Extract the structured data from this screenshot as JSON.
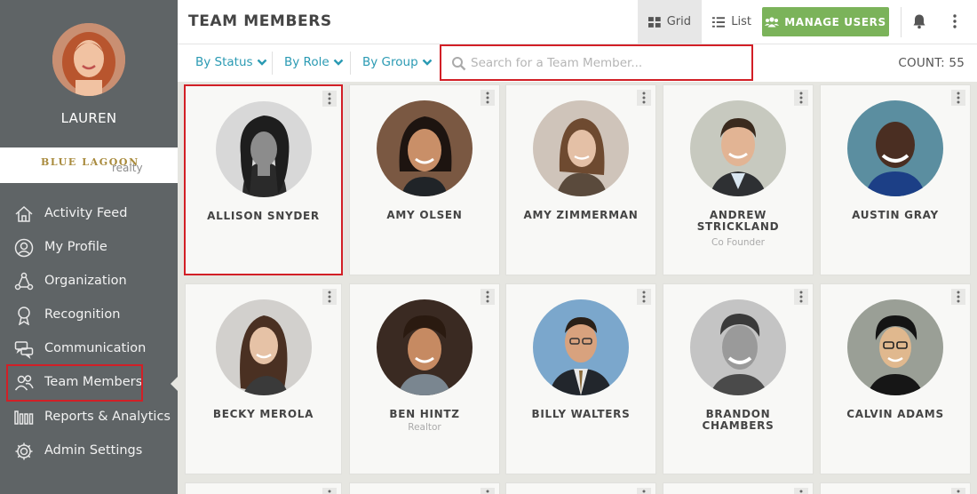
{
  "sidebar": {
    "user_name": "LAUREN",
    "brand_top": "BLUE LAGOON",
    "brand_bottom": "realty",
    "items": [
      {
        "label": "Activity Feed",
        "icon": "home-icon"
      },
      {
        "label": "My Profile",
        "icon": "user-circle-icon"
      },
      {
        "label": "Organization",
        "icon": "organization-icon"
      },
      {
        "label": "Recognition",
        "icon": "ribbon-icon"
      },
      {
        "label": "Communication",
        "icon": "chat-bubbles-icon"
      },
      {
        "label": "Team Members",
        "icon": "team-icon",
        "active": true
      },
      {
        "label": "Reports & Analytics",
        "icon": "bar-chart-icon"
      },
      {
        "label": "Admin Settings",
        "icon": "gear-icon"
      }
    ]
  },
  "header": {
    "title": "TEAM MEMBERS",
    "grid_label": "Grid",
    "list_label": "List",
    "manage_label": "MANAGE USERS"
  },
  "filters": {
    "status": "By Status",
    "role": "By Role",
    "group": "By Group"
  },
  "search": {
    "placeholder": "Search for a Team Member..."
  },
  "count_label": "COUNT: 55",
  "members": [
    {
      "name": "ALLISON SNYDER",
      "title": ""
    },
    {
      "name": "AMY OLSEN",
      "title": ""
    },
    {
      "name": "AMY ZIMMERMAN",
      "title": ""
    },
    {
      "name": "ANDREW STRICKLAND",
      "title": "Co Founder"
    },
    {
      "name": "AUSTIN GRAY",
      "title": ""
    },
    {
      "name": "BECKY MEROLA",
      "title": ""
    },
    {
      "name": "BEN HINTZ",
      "title": "Realtor"
    },
    {
      "name": "BILLY WALTERS",
      "title": ""
    },
    {
      "name": "BRANDON CHAMBERS",
      "title": ""
    },
    {
      "name": "CALVIN ADAMS",
      "title": ""
    }
  ],
  "colors": {
    "sidebar_bg": "#5f6466",
    "accent_teal": "#2a9ab3",
    "manage_green": "#7bb35a",
    "highlight_red": "#d21f26"
  }
}
